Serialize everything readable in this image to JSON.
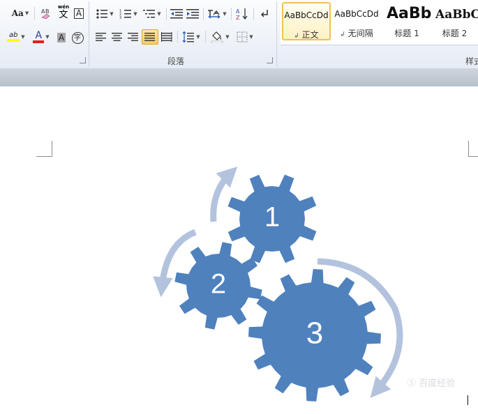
{
  "font": {
    "change_case_label": "Aa",
    "phonetic_icon_text": "wén",
    "phonetic_icon_char": "文",
    "char_border_letter": "A",
    "highlight_letters": "ab",
    "font_color_letter": "A",
    "char_shading_letter": "A",
    "enclose_char": "字"
  },
  "paragraph": {
    "group_label": "段落"
  },
  "styles": {
    "group_label": "样式",
    "items": [
      {
        "sample": "AaBbCcDd",
        "name": "正文",
        "mark": "↲"
      },
      {
        "sample": "AaBbCcDd",
        "name": "无间隔",
        "mark": "↲"
      },
      {
        "sample": "AaBb",
        "name": "标题 1",
        "mark": ""
      },
      {
        "sample": "AaBbC",
        "name": "标题 2",
        "mark": ""
      }
    ]
  },
  "smartart": {
    "gear_labels": [
      "1",
      "2",
      "3"
    ],
    "gear_color": "#4f81bd",
    "arrow_color": "#b3c3de"
  },
  "colors": {
    "highlight": "#ffff00",
    "font_color": "#e02020"
  },
  "watermark": "Ⓢ 百度经验"
}
